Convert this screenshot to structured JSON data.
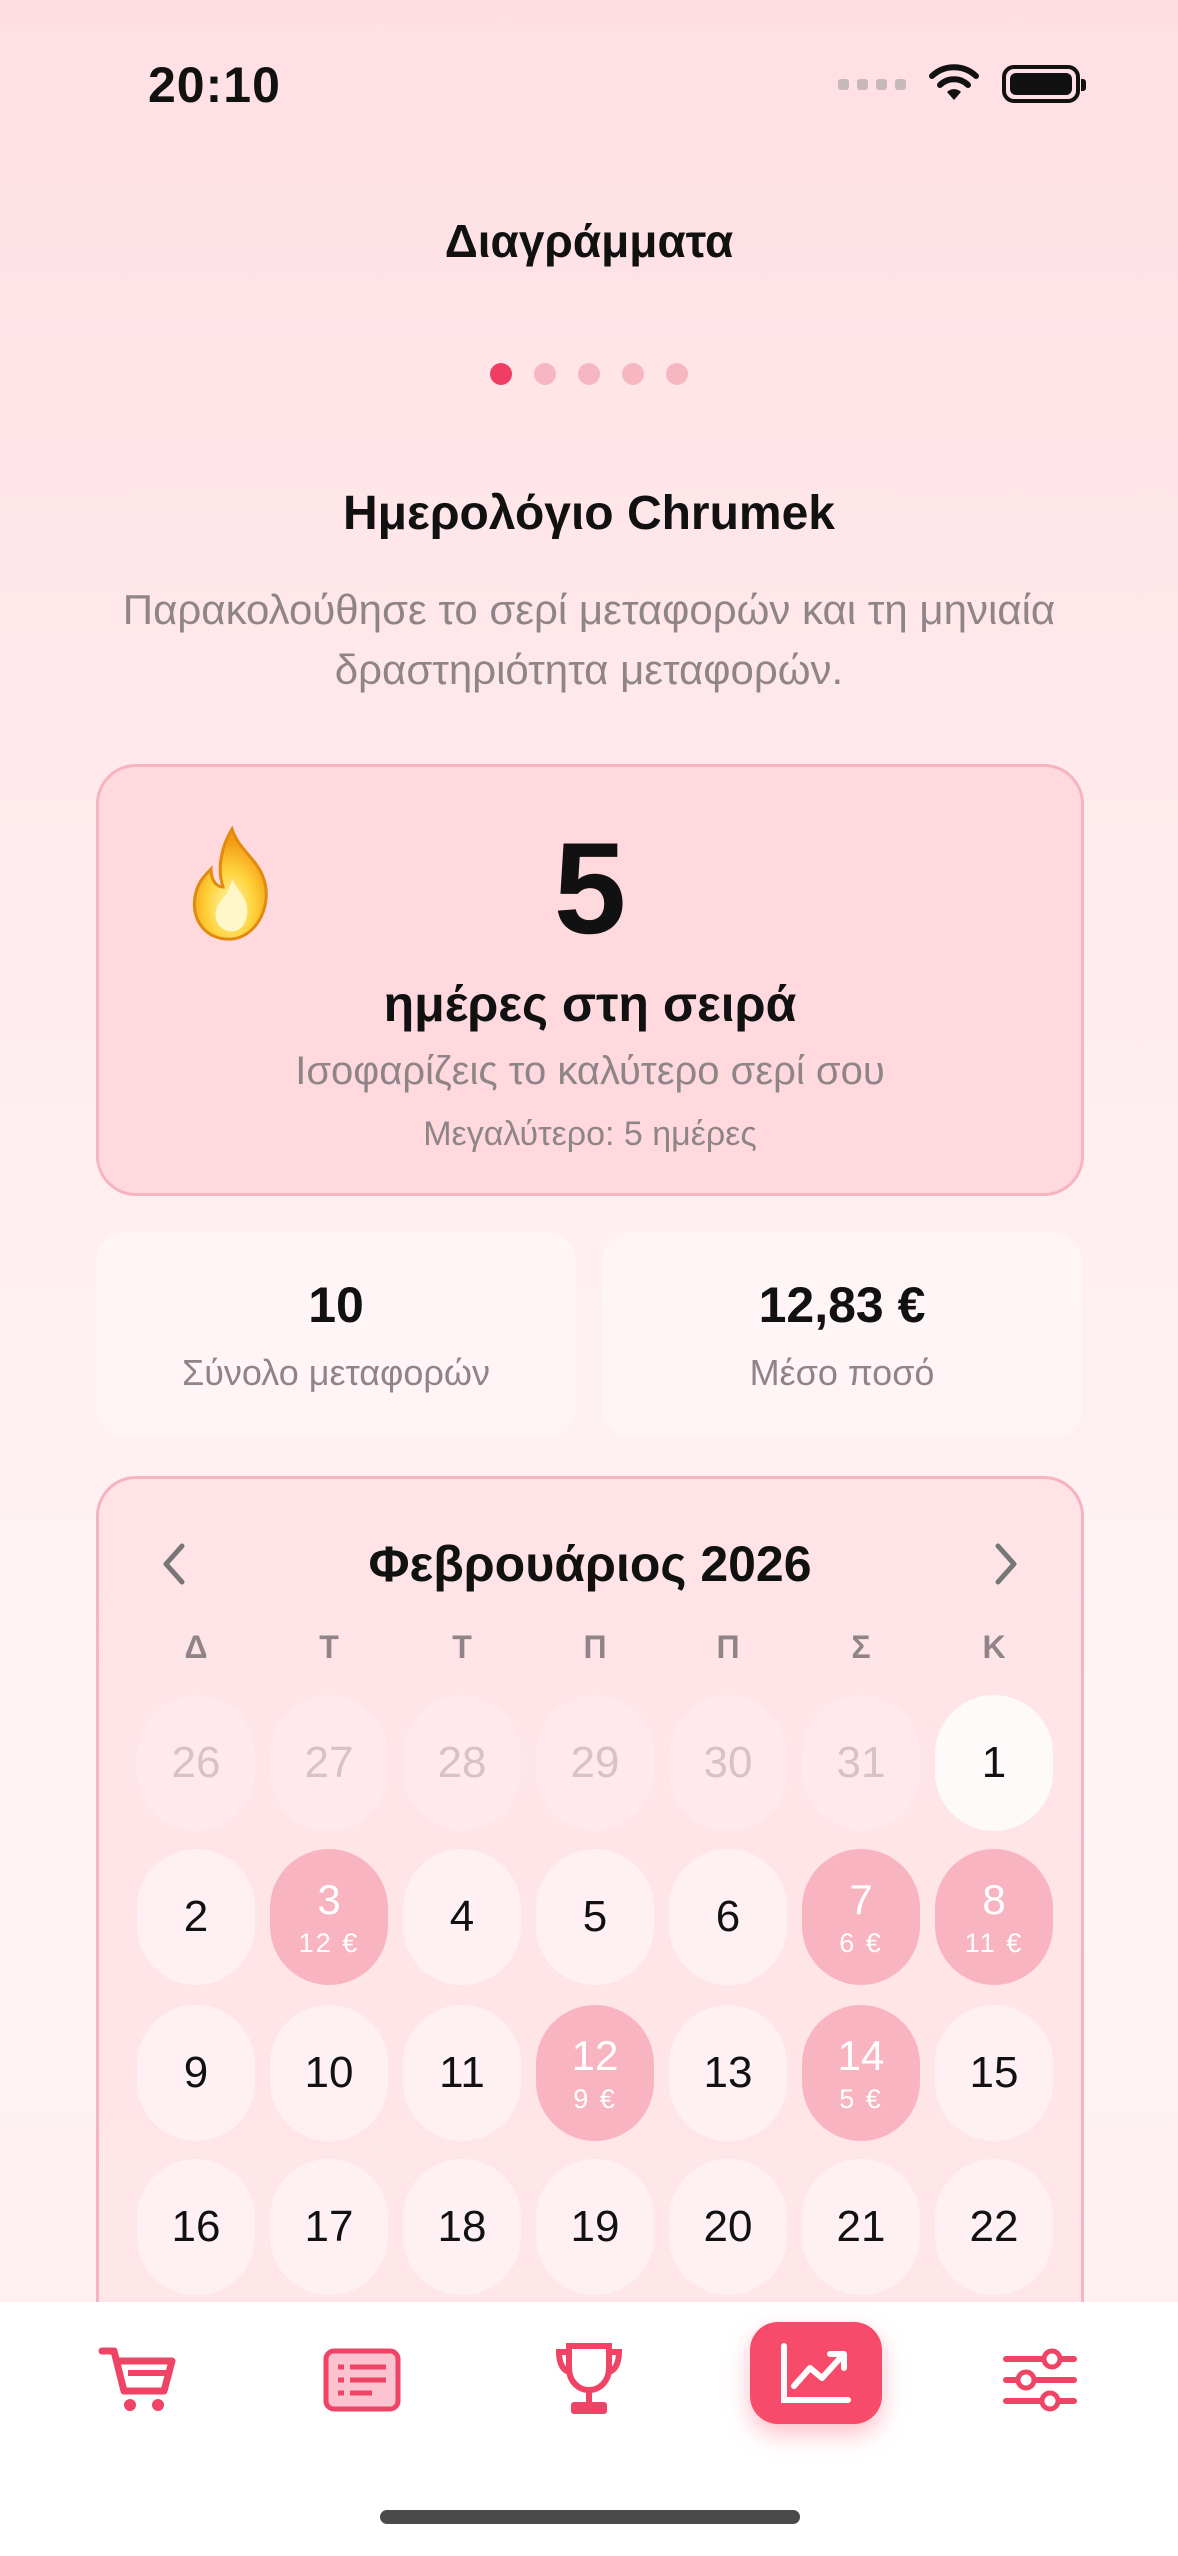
{
  "status_bar": {
    "time": "20:10"
  },
  "header": {
    "title": "Διαγράμματα",
    "page_count": 5,
    "active_page": 1
  },
  "section": {
    "title": "Ημερολόγιο Chrumek",
    "subtitle": "Παρακολούθησε το σερί μεταφορών και τη μηνιαία δραστηριότητα μεταφορών."
  },
  "streak": {
    "count": "5",
    "label": "ημέρες στη σειρά",
    "note": "Ισοφαρίζεις το καλύτερο σερί σου",
    "best": "Μεγαλύτερο: 5 ημέρες"
  },
  "stats": {
    "total_value": "10",
    "total_label": "Σύνολο μεταφορών",
    "avg_value": "12,83 €",
    "avg_label": "Μέσο ποσό"
  },
  "calendar": {
    "month": "Φεβρουάριος 2026",
    "weekdays": [
      "Δ",
      "Τ",
      "Τ",
      "Π",
      "Π",
      "Σ",
      "Κ"
    ],
    "rows": [
      [
        {
          "d": "26",
          "s": "faded"
        },
        {
          "d": "27",
          "s": "faded"
        },
        {
          "d": "28",
          "s": "faded"
        },
        {
          "d": "29",
          "s": "faded"
        },
        {
          "d": "30",
          "s": "faded"
        },
        {
          "d": "31",
          "s": "faded"
        },
        {
          "d": "1",
          "s": "white"
        }
      ],
      [
        {
          "d": "2"
        },
        {
          "d": "3",
          "s": "active",
          "a": "12 €"
        },
        {
          "d": "4"
        },
        {
          "d": "5"
        },
        {
          "d": "6"
        },
        {
          "d": "7",
          "s": "active",
          "a": "6 €"
        },
        {
          "d": "8",
          "s": "active",
          "a": "11 €"
        }
      ],
      [
        {
          "d": "9"
        },
        {
          "d": "10"
        },
        {
          "d": "11"
        },
        {
          "d": "12",
          "s": "active",
          "a": "9 €"
        },
        {
          "d": "13"
        },
        {
          "d": "14",
          "s": "active",
          "a": "5 €"
        },
        {
          "d": "15"
        }
      ],
      [
        {
          "d": "16"
        },
        {
          "d": "17"
        },
        {
          "d": "18"
        },
        {
          "d": "19"
        },
        {
          "d": "20"
        },
        {
          "d": "21"
        },
        {
          "d": "22"
        }
      ]
    ]
  },
  "tabs": [
    {
      "icon": "cart-icon",
      "name": "tab-shop"
    },
    {
      "icon": "list-icon",
      "name": "tab-list"
    },
    {
      "icon": "trophy-icon",
      "name": "tab-trophies"
    },
    {
      "icon": "chart-icon",
      "name": "tab-charts",
      "active": true
    },
    {
      "icon": "sliders-icon",
      "name": "tab-settings"
    }
  ],
  "colors": {
    "accent": "#f64b6a",
    "active_day": "#f9b4c1",
    "dot_active": "#ef3d63"
  }
}
